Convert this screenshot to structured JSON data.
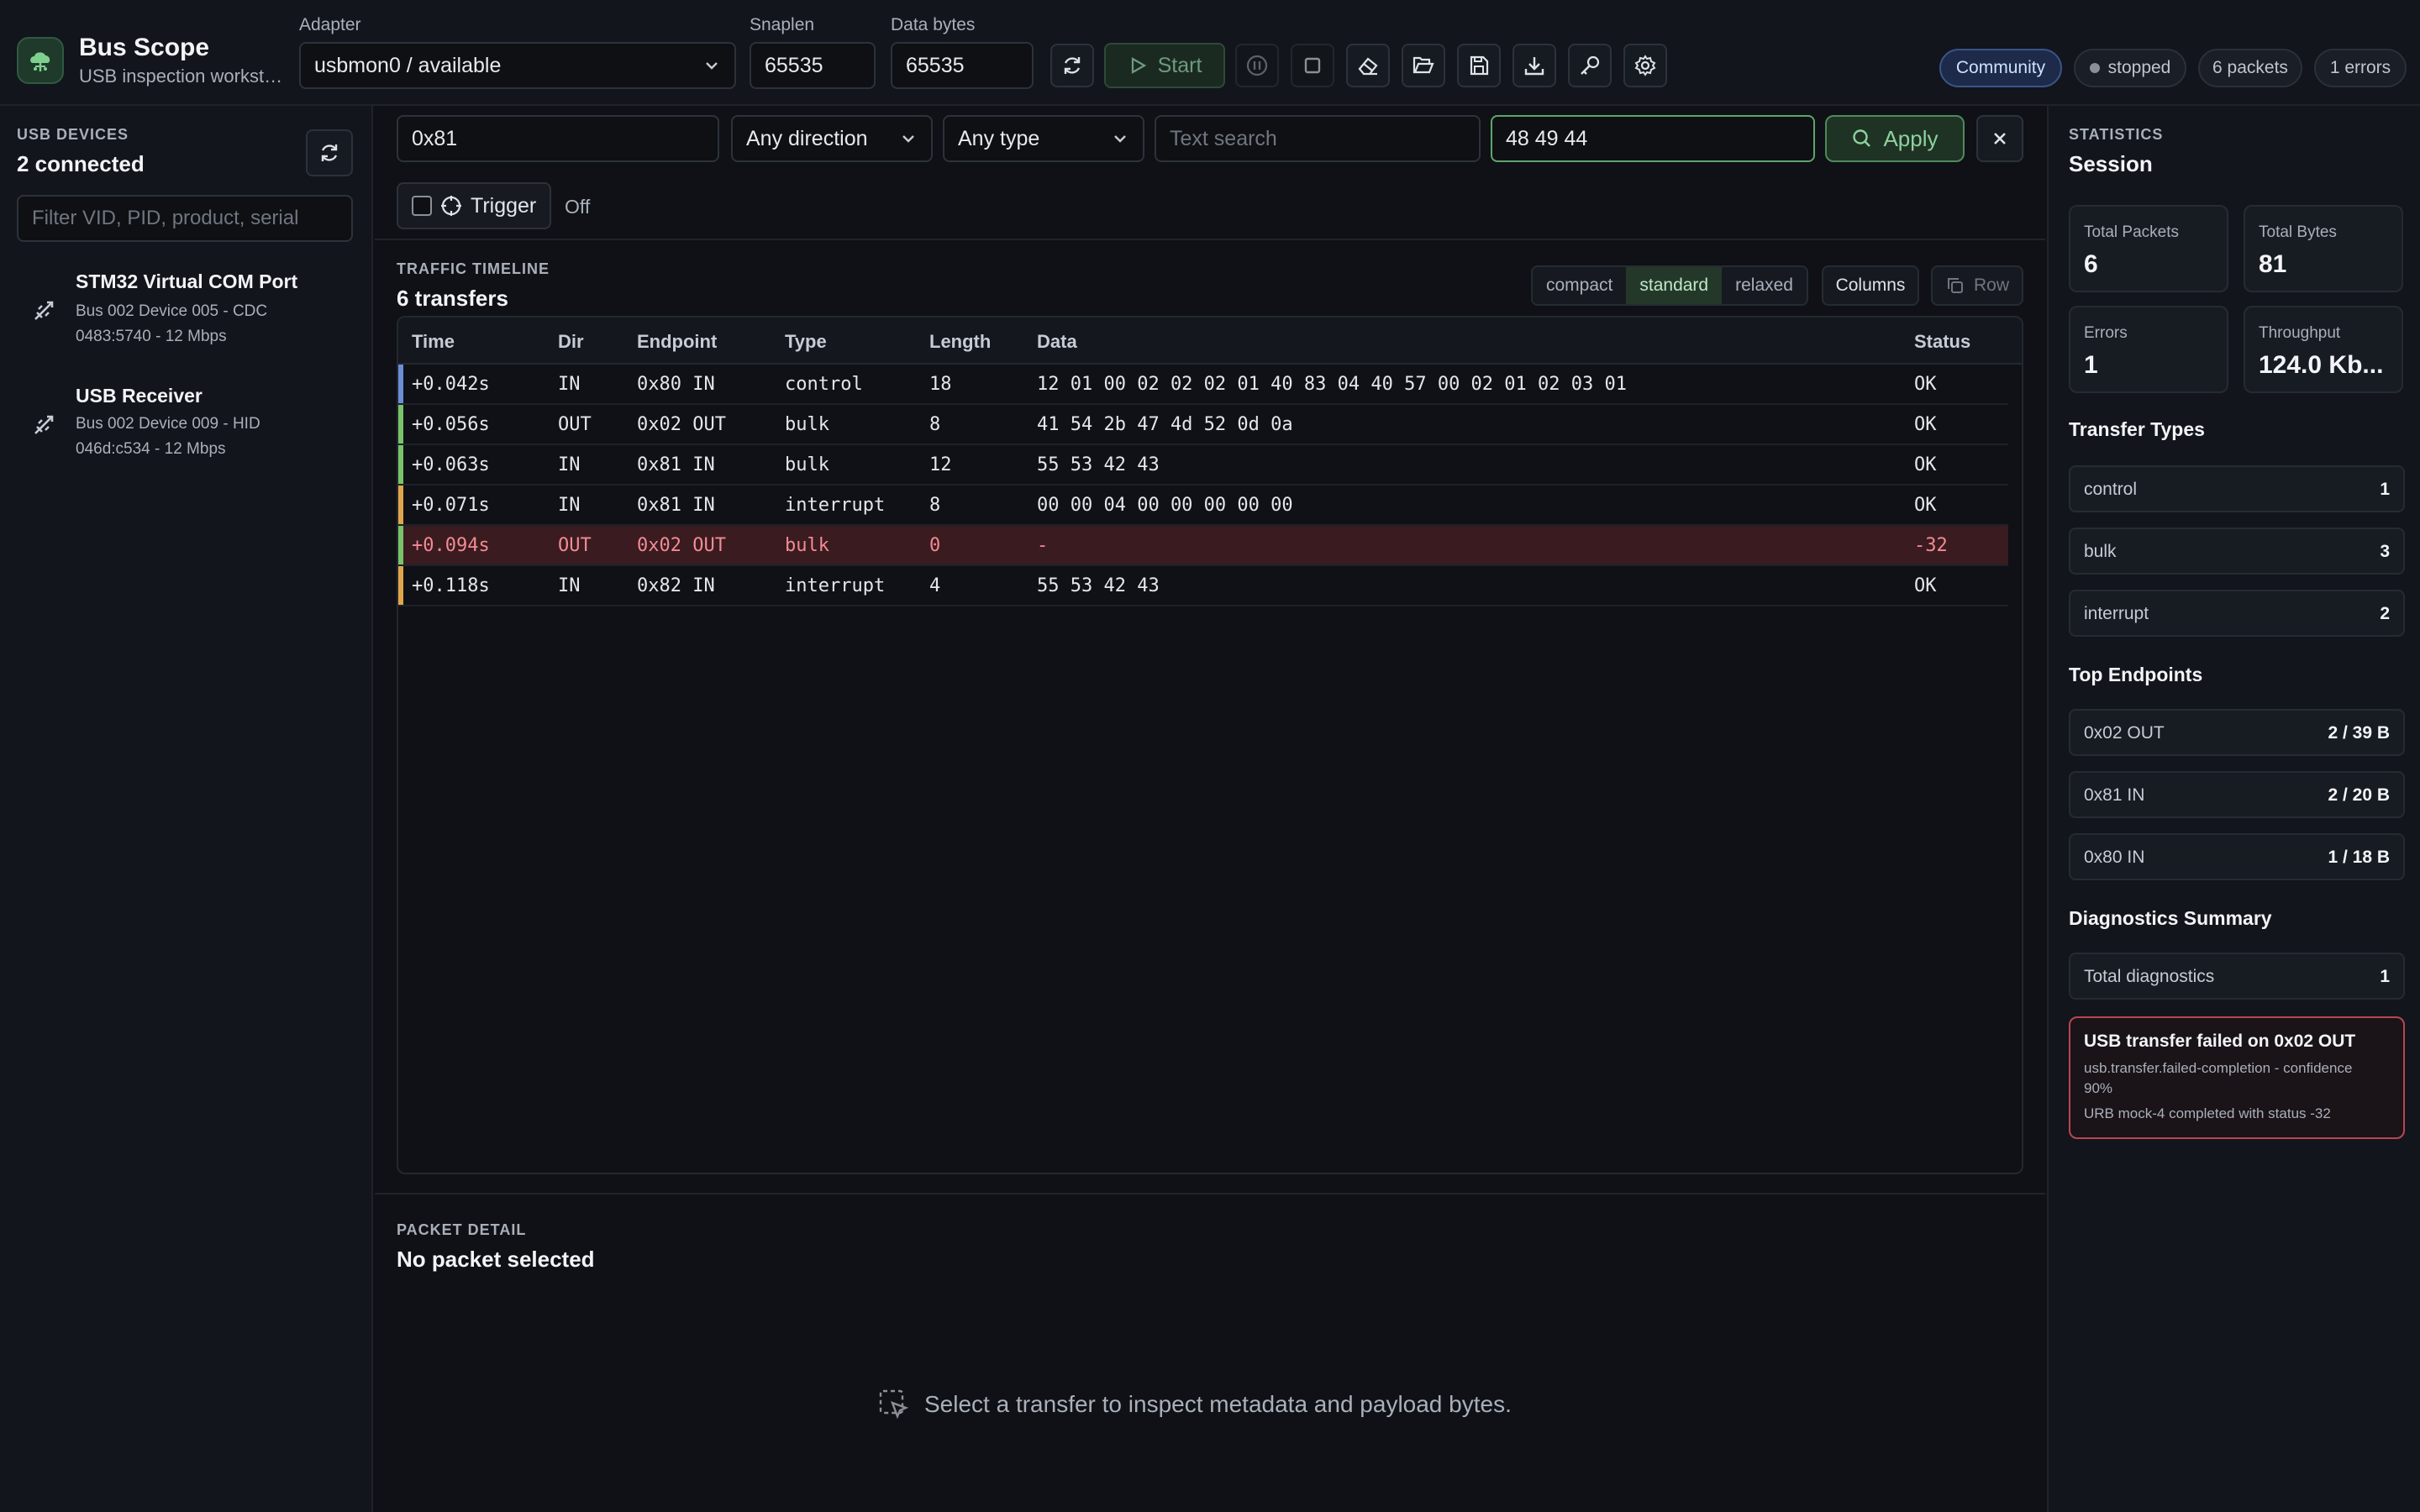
{
  "app": {
    "title": "Bus Scope",
    "subtitle": "USB inspection workstat..."
  },
  "toolbar": {
    "adapter_label": "Adapter",
    "adapter_value": "usbmon0 / available",
    "snaplen_label": "Snaplen",
    "snaplen_value": "65535",
    "databytes_label": "Data bytes",
    "databytes_value": "65535",
    "start_label": "Start"
  },
  "status": {
    "edition": "Community",
    "state": "stopped",
    "packets": "6 packets",
    "errors": "1 errors"
  },
  "devices": {
    "section_label": "USB DEVICES",
    "count_label": "2 connected",
    "filter_placeholder": "Filter VID, PID, product, serial",
    "items": [
      {
        "name": "STM32 Virtual COM Port",
        "line1": "Bus 002 Device 005 - CDC",
        "line2": "0483:5740 - 12 Mbps"
      },
      {
        "name": "USB Receiver",
        "line1": "Bus 002 Device 009 - HID",
        "line2": "046d:c534 - 12 Mbps"
      }
    ]
  },
  "filters": {
    "endpoint_value": "0x81",
    "direction_value": "Any direction",
    "type_value": "Any type",
    "text_placeholder": "Text search",
    "bytes_value": "48 49 44",
    "apply_label": "Apply",
    "trigger_label": "Trigger",
    "trigger_state": "Off"
  },
  "timeline": {
    "section_label": "TRAFFIC TIMELINE",
    "count_label": "6 transfers",
    "density": [
      "compact",
      "standard",
      "relaxed"
    ],
    "density_active": "standard",
    "columns_label": "Columns",
    "row_label": "Row",
    "headers": [
      "Time",
      "Dir",
      "Endpoint",
      "Type",
      "Length",
      "Data",
      "Status"
    ],
    "rows": [
      {
        "time": "+0.042s",
        "dir": "IN",
        "endpoint": "0x80 IN",
        "type": "control",
        "length": "18",
        "data": "12 01 00 02 02 02 01 40 83 04 40 57 00 02 01 02 03 01",
        "status": "OK",
        "error": false,
        "type_color": "#6b8fd6"
      },
      {
        "time": "+0.056s",
        "dir": "OUT",
        "endpoint": "0x02 OUT",
        "type": "bulk",
        "length": "8",
        "data": "41 54 2b 47 4d 52 0d 0a",
        "status": "OK",
        "error": false,
        "type_color": "#79c36a"
      },
      {
        "time": "+0.063s",
        "dir": "IN",
        "endpoint": "0x81 IN",
        "type": "bulk",
        "length": "12",
        "data": "55 53 42 43",
        "status": "OK",
        "error": false,
        "type_color": "#79c36a"
      },
      {
        "time": "+0.071s",
        "dir": "IN",
        "endpoint": "0x81 IN",
        "type": "interrupt",
        "length": "8",
        "data": "00 00 04 00 00 00 00 00",
        "status": "OK",
        "error": false,
        "type_color": "#e0a64b"
      },
      {
        "time": "+0.094s",
        "dir": "OUT",
        "endpoint": "0x02 OUT",
        "type": "bulk",
        "length": "0",
        "data": "-",
        "status": "-32",
        "error": true,
        "type_color": "#79c36a"
      },
      {
        "time": "+0.118s",
        "dir": "IN",
        "endpoint": "0x82 IN",
        "type": "interrupt",
        "length": "4",
        "data": "55 53 42 43",
        "status": "OK",
        "error": false,
        "type_color": "#e0a64b"
      }
    ]
  },
  "packet_detail": {
    "section_label": "PACKET DETAIL",
    "title": "No packet selected",
    "empty_hint": "Select a transfer to inspect metadata and payload bytes."
  },
  "stats": {
    "section_label": "STATISTICS",
    "title": "Session",
    "cards": [
      {
        "label": "Total Packets",
        "value": "6"
      },
      {
        "label": "Total Bytes",
        "value": "81"
      },
      {
        "label": "Errors",
        "value": "1"
      },
      {
        "label": "Throughput",
        "value": "124.0 Kb..."
      }
    ],
    "transfer_types_title": "Transfer Types",
    "transfer_types": [
      {
        "name": "control",
        "count": "1"
      },
      {
        "name": "bulk",
        "count": "3"
      },
      {
        "name": "interrupt",
        "count": "2"
      }
    ],
    "top_endpoints_title": "Top Endpoints",
    "top_endpoints": [
      {
        "name": "0x02 OUT",
        "value": "2 / 39 B"
      },
      {
        "name": "0x81 IN",
        "value": "2 / 20 B"
      },
      {
        "name": "0x80 IN",
        "value": "1 / 18 B"
      }
    ],
    "diagnostics_title": "Diagnostics Summary",
    "diagnostics_total_label": "Total diagnostics",
    "diagnostics_total": "1",
    "diagnostic": {
      "title": "USB transfer failed on 0x02 OUT",
      "line1": "usb.transfer.failed-completion - confidence",
      "line2": "90%",
      "line3": "URB mock-4 completed with status -32"
    }
  },
  "colors": {
    "accent_green": "#8fd19e",
    "error_red": "#f28b93",
    "community_blue": "#3b5388"
  }
}
